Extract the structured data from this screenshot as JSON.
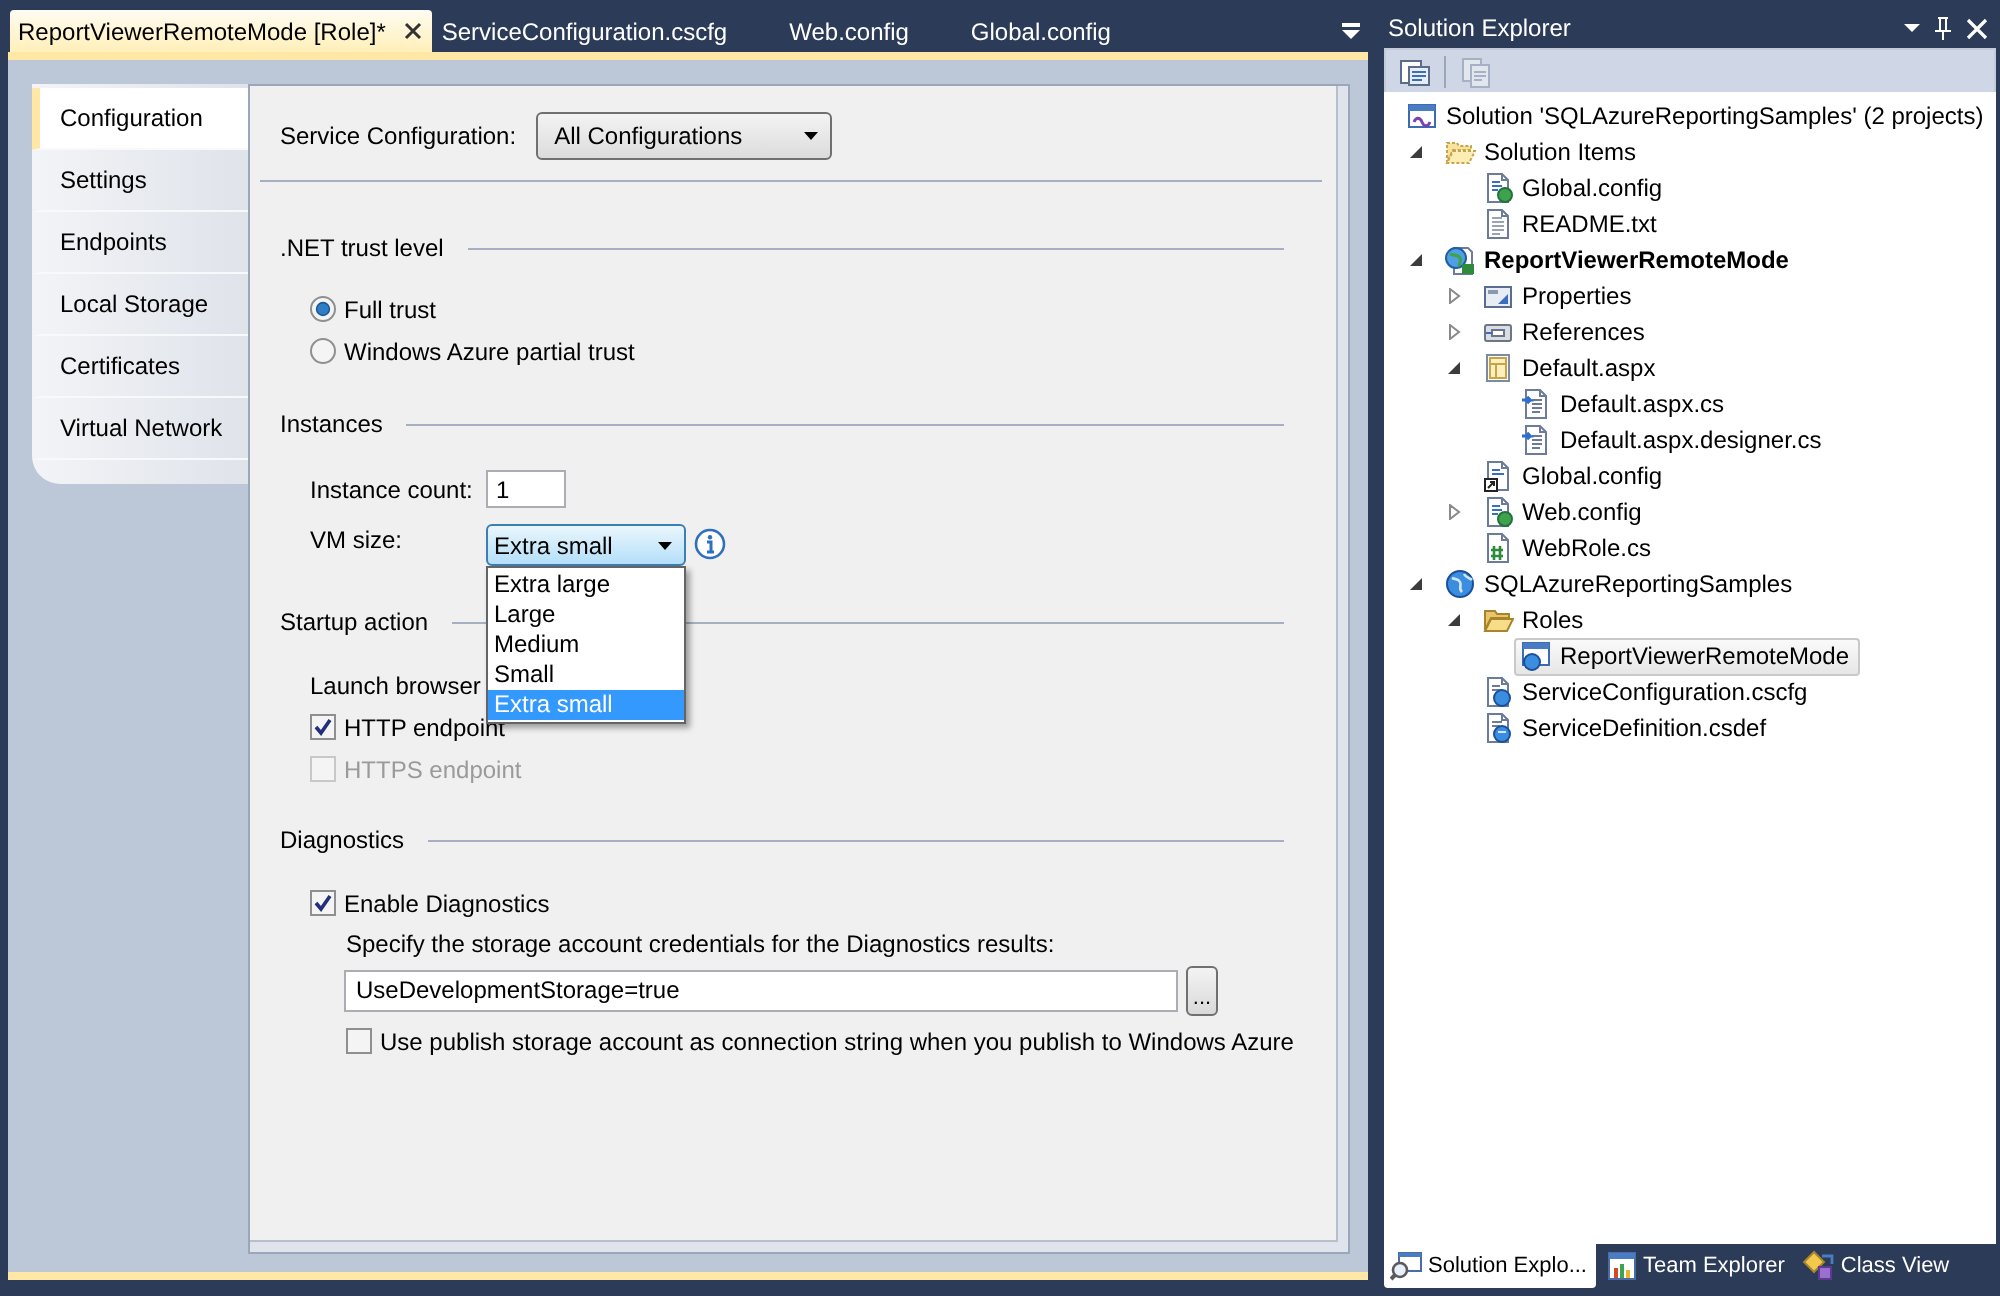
{
  "document_tabs": [
    {
      "label": "ReportViewerRemoteMode [Role]*",
      "selected": true
    },
    {
      "label": "ServiceConfiguration.cscfg",
      "selected": false
    },
    {
      "label": "Web.config",
      "selected": false
    },
    {
      "label": "Global.config",
      "selected": false
    }
  ],
  "role_designer": {
    "tabs": [
      {
        "label": "Configuration",
        "selected": true
      },
      {
        "label": "Settings",
        "selected": false
      },
      {
        "label": "Endpoints",
        "selected": false
      },
      {
        "label": "Local Storage",
        "selected": false
      },
      {
        "label": "Certificates",
        "selected": false
      },
      {
        "label": "Virtual Network",
        "selected": false
      }
    ],
    "service_configuration": {
      "label": "Service Configuration:",
      "value": "All Configurations"
    },
    "trust_level": {
      "title": ".NET trust level",
      "options": [
        {
          "label": "Full trust",
          "selected": true
        },
        {
          "label": "Windows Azure partial trust",
          "selected": false
        }
      ]
    },
    "instances": {
      "title": "Instances",
      "instance_count": {
        "label": "Instance count:",
        "value": "1"
      },
      "vm_size": {
        "label": "VM size:",
        "value": "Extra small",
        "expanded": true,
        "options": [
          {
            "label": "Extra large",
            "selected": false
          },
          {
            "label": "Large",
            "selected": false
          },
          {
            "label": "Medium",
            "selected": false
          },
          {
            "label": "Small",
            "selected": false
          },
          {
            "label": "Extra small",
            "selected": true
          }
        ]
      }
    },
    "startup_action": {
      "title": "Startup action",
      "launch_browser_label": "Launch browser",
      "endpoints": [
        {
          "label": "HTTP endpoint",
          "checked": true,
          "disabled": false
        },
        {
          "label": "HTTPS endpoint",
          "checked": false,
          "disabled": true
        }
      ]
    },
    "diagnostics": {
      "title": "Diagnostics",
      "enable": {
        "label": "Enable Diagnostics",
        "checked": true
      },
      "credentials_label": "Specify the storage account credentials for the Diagnostics results:",
      "credentials_value": "UseDevelopmentStorage=true",
      "browse_button": "...",
      "use_publish_account": {
        "label": "Use publish storage account as connection string when you publish to Windows Azure",
        "checked": false
      }
    }
  },
  "solution_explorer": {
    "title": "Solution Explorer",
    "toolbar_buttons": [
      {
        "disabled": false
      },
      {
        "disabled": true
      }
    ],
    "tree": [
      {
        "label": "Solution 'SQLAzureReportingSamples' (2 projects)",
        "kind": "solution",
        "selected": false,
        "children": [
          {
            "label": "Solution Items",
            "kind": "solution-folder",
            "selected": false,
            "expanded": true,
            "children": [
              {
                "label": "Global.config",
                "kind": "config",
                "selected": false
              },
              {
                "label": "README.txt",
                "kind": "text",
                "selected": false
              }
            ]
          },
          {
            "label": "ReportViewerRemoteMode",
            "kind": "web-project",
            "selected": false,
            "bold": true,
            "expanded": true,
            "children": [
              {
                "label": "Properties",
                "kind": "properties",
                "selected": false,
                "expanded": false
              },
              {
                "label": "References",
                "kind": "references",
                "selected": false,
                "expanded": false
              },
              {
                "label": "Default.aspx",
                "kind": "page",
                "selected": false,
                "expanded": true,
                "children": [
                  {
                    "label": "Default.aspx.cs",
                    "kind": "code",
                    "selected": false
                  },
                  {
                    "label": "Default.aspx.designer.cs",
                    "kind": "code",
                    "selected": false
                  }
                ]
              },
              {
                "label": "Global.config",
                "kind": "linked-config",
                "selected": false
              },
              {
                "label": "Web.config",
                "kind": "config",
                "selected": false,
                "expanded": false
              },
              {
                "label": "WebRole.cs",
                "kind": "csharp",
                "selected": false
              }
            ]
          },
          {
            "label": "SQLAzureReportingSamples",
            "kind": "cloud-project",
            "selected": false,
            "expanded": true,
            "children": [
              {
                "label": "Roles",
                "kind": "folder",
                "selected": false,
                "expanded": true,
                "children": [
                  {
                    "label": "ReportViewerRemoteMode",
                    "kind": "role",
                    "selected": true
                  }
                ]
              },
              {
                "label": "ServiceConfiguration.cscfg",
                "kind": "service-config",
                "selected": false
              },
              {
                "label": "ServiceDefinition.csdef",
                "kind": "service-definition",
                "selected": false
              }
            ]
          }
        ]
      }
    ],
    "bottom_tabs": [
      {
        "label": "Solution Explo...",
        "selected": true
      },
      {
        "label": "Team Explorer",
        "selected": false
      },
      {
        "label": "Class View",
        "selected": false
      }
    ]
  }
}
